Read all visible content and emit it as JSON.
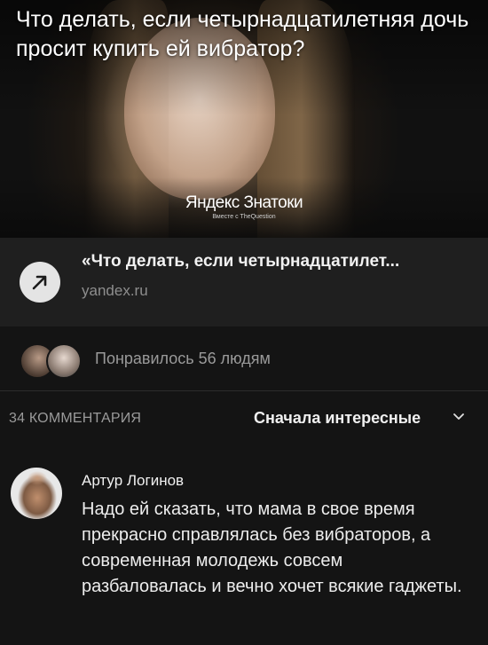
{
  "post": {
    "image_title": "Что делать, если четырнадцатилетняя дочь просит купить ей вибратор?",
    "watermark_main": "Яндекс Знатоки",
    "watermark_sub": "Вместе с TheQuestion"
  },
  "link": {
    "title": "«Что делать, если четырнадцатилет...",
    "domain": "yandex.ru",
    "icon": "external-link-arrow-icon"
  },
  "likes": {
    "text": "Понравилось 56 людям"
  },
  "comments": {
    "count_label": "34 КОММЕНТАРИЯ",
    "sort_label": "Сначала интересные",
    "items": [
      {
        "author": "Артур Логинов",
        "text": "Надо ей сказать, что мама в свое время прекрасно справлялась без вибраторов, а современная молодежь совсем разбаловалась и вечно хочет всякие гаджеты."
      }
    ]
  },
  "colors": {
    "background": "#141414",
    "card": "#1f1f1f",
    "muted_text": "#9a9a9a"
  }
}
